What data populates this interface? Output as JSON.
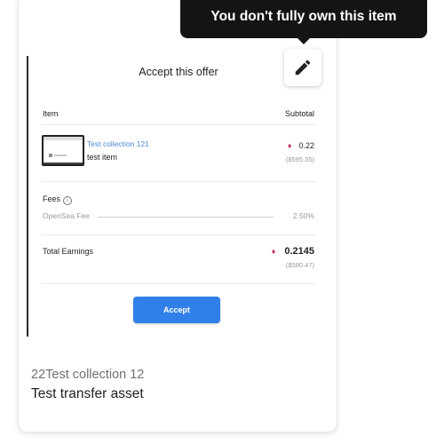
{
  "tooltip": {
    "text": "You don't fully own this item"
  },
  "edit_button": {
    "icon": "pencil-icon"
  },
  "offer": {
    "title": "Accept this offer",
    "columns": {
      "item": "Item",
      "subtotal": "Subtotal"
    },
    "item": {
      "collection": "Test collection 121",
      "name": "test item",
      "price_eth": "0.22",
      "price_usd": "($595.35)"
    },
    "fees": {
      "label": "Fees",
      "info_icon": "info-icon",
      "rows": [
        {
          "name": "OpenSea Fee",
          "value": "2.50%"
        }
      ]
    },
    "total": {
      "label": "Total Earnings",
      "eth": "0.2145",
      "usd": "($580.47)"
    },
    "accept_label": "Accept"
  },
  "card": {
    "collection": "22Test collection 12",
    "asset_name": "Test transfer asset"
  },
  "colors": {
    "accent": "#2f80e8",
    "link": "#4a88d8",
    "eth": "#c43a5c",
    "tooltip_bg": "#141414"
  }
}
